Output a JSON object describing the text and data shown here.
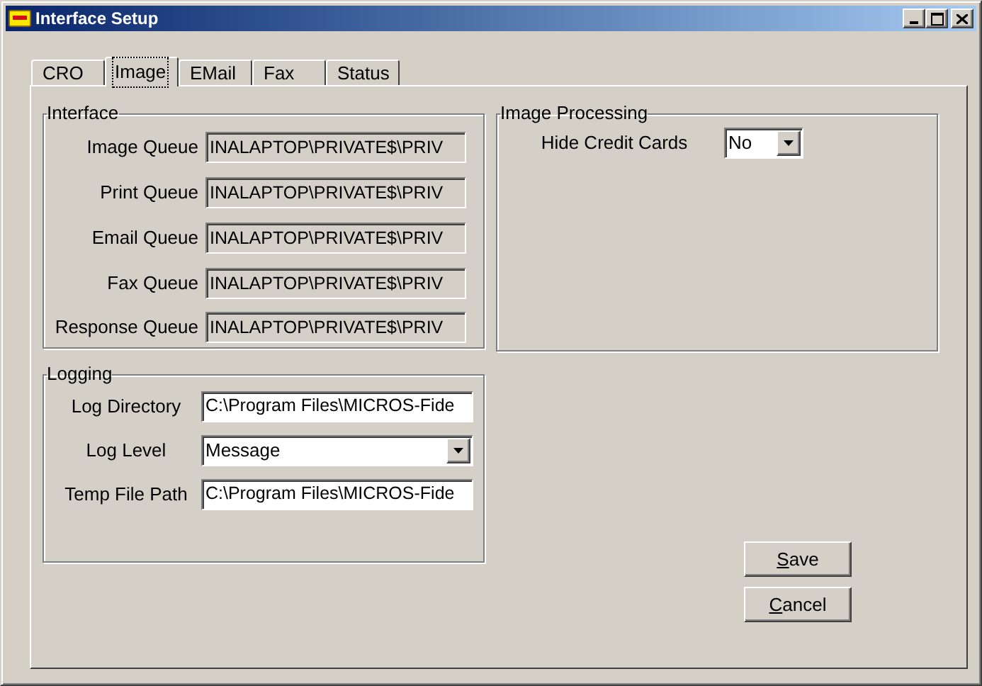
{
  "window": {
    "title": "Interface Setup"
  },
  "tabs": [
    {
      "label": "CRO",
      "selected": false
    },
    {
      "label": "Image",
      "selected": true
    },
    {
      "label": "EMail",
      "selected": false
    },
    {
      "label": "Fax",
      "selected": false
    },
    {
      "label": "Status",
      "selected": false
    }
  ],
  "interface": {
    "title": "Interface",
    "fields": [
      {
        "label": "Image Queue",
        "value": "INALAPTOP\\PRIVATE$\\PRIV",
        "read_only": true
      },
      {
        "label": "Print Queue",
        "value": "INALAPTOP\\PRIVATE$\\PRIV",
        "read_only": true
      },
      {
        "label": "Email Queue",
        "value": "INALAPTOP\\PRIVATE$\\PRIV",
        "read_only": true
      },
      {
        "label": "Fax Queue",
        "value": "INALAPTOP\\PRIVATE$\\PRIV",
        "read_only": true
      },
      {
        "label": "Response Queue",
        "value": "INALAPTOP\\PRIVATE$\\PRIV",
        "read_only": true
      }
    ]
  },
  "logging": {
    "title": "Logging",
    "fields": [
      {
        "label": "Log Directory",
        "kind": "text",
        "value": "C:\\Program Files\\MICROS-Fide"
      },
      {
        "label": "Log Level",
        "kind": "dropdown",
        "value": "Message"
      },
      {
        "label": "Temp File Path",
        "kind": "text",
        "value": "C:\\Program Files\\MICROS-Fide"
      }
    ]
  },
  "image_processing": {
    "title": "Image Processing",
    "fields": [
      {
        "label": "Hide Credit Cards",
        "kind": "dropdown",
        "value": "No"
      }
    ]
  },
  "buttons": [
    {
      "label": "Save",
      "underline_first": true
    },
    {
      "label": "Cancel",
      "underline_first": true
    }
  ]
}
